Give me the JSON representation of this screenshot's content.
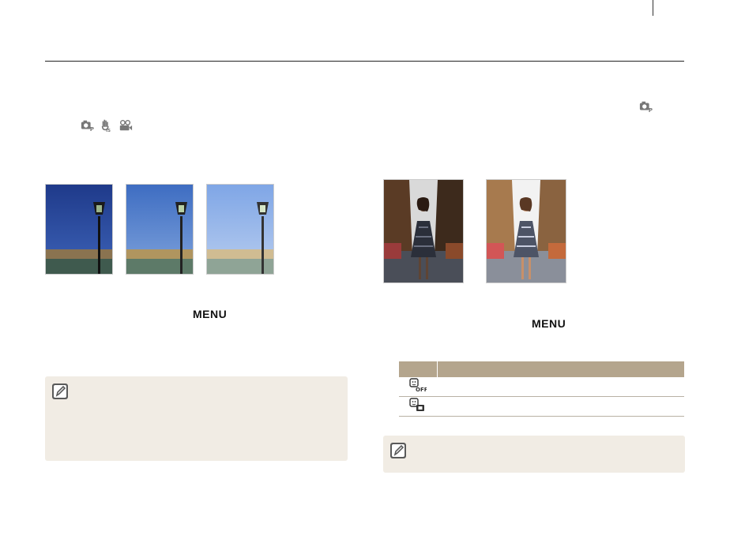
{
  "left": {
    "mode_icons": [
      "camera-p-icon",
      "dual-is-hand-icon",
      "movie-camera-icon"
    ],
    "photos": [
      "exposure-darker-photo",
      "exposure-normal-photo",
      "exposure-brighter-photo"
    ],
    "menu_key": "MENU"
  },
  "right": {
    "mode_icon": "camera-p-icon",
    "photos": [
      "backlight-off-photo",
      "backlight-on-photo"
    ],
    "menu_key": "MENU",
    "table_rows": [
      {
        "icon": "backlight-off-icon",
        "text": ""
      },
      {
        "icon": "backlight-on-icon",
        "text": ""
      }
    ]
  },
  "colors": {
    "note_background": "#f1ece4",
    "table_header": "#b4a58d",
    "rule": "#222222"
  }
}
